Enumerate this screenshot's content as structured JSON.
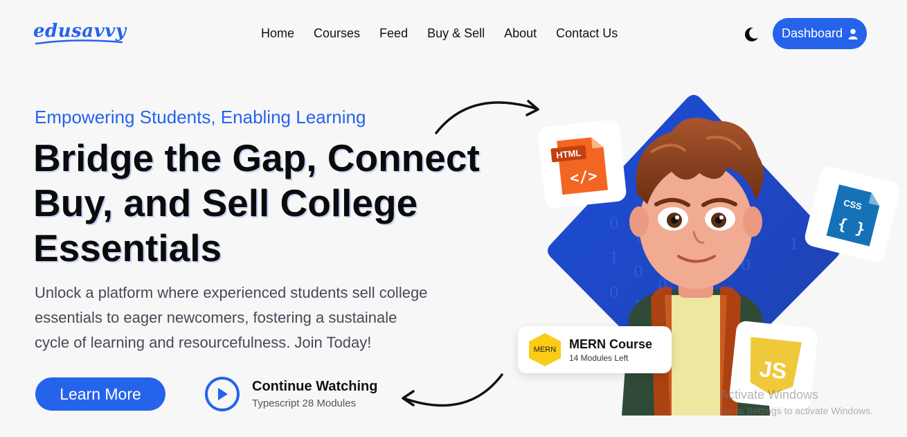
{
  "brand": {
    "logo_text": "edusavvy"
  },
  "nav": {
    "items": [
      {
        "label": "Home"
      },
      {
        "label": "Courses"
      },
      {
        "label": "Feed"
      },
      {
        "label": "Buy & Sell"
      },
      {
        "label": "About"
      },
      {
        "label": "Contact Us"
      }
    ]
  },
  "header": {
    "theme_icon": "moon-icon",
    "dashboard_label": "Dashboard",
    "dashboard_icon": "user-icon"
  },
  "hero": {
    "eyebrow": "Empowering Students, Enabling Learning",
    "headline": "Bridge the Gap, Connect Buy, and Sell College Essentials",
    "description_lines": [
      "Unlock a platform where experienced students sell college",
      "essentials to eager newcomers, fostering a sustainale",
      "cycle of learning and resourcefulness. Join Today!"
    ],
    "learn_more_label": "Learn More",
    "continue": {
      "title": "Continue Watching",
      "subtitle": "Typescript 28 Modules"
    }
  },
  "badges": {
    "html": "HTML",
    "html_symbol": "</>",
    "css": "CSS",
    "css_symbol": "{ }",
    "js": "JS",
    "mern": {
      "badge": "MERN",
      "title": "MERN Course",
      "subtitle": "14 Modules Left"
    }
  },
  "watermark": {
    "title": "Activate Windows",
    "subtitle": "Go to Settings to activate Windows."
  },
  "colors": {
    "accent": "#2563eb",
    "html_orange": "#f26522",
    "css_blue": "#1572b6",
    "js_yellow": "#f0c93a"
  }
}
